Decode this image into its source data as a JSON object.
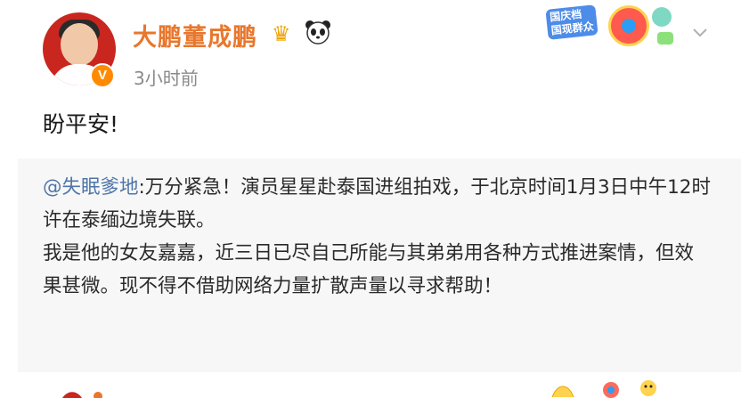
{
  "post": {
    "username": "大鹏董成鹏",
    "timestamp": "3小时前",
    "verified_badge": "V",
    "text": "盼平安!"
  },
  "header_decoration": {
    "banner_text": "国庆档 国现群众"
  },
  "repost": {
    "mention": "@失眠爹地",
    "line1": ":万分紧急！演员星星赴泰国进组拍戏，于北京时间1月3日中午12时许在泰缅边境失联。",
    "line2": "我是他的女友嘉嘉，近三日已尽自己所能与其弟弟用各种方式推进案情，但效果甚微。现不得不借助网络力量扩散声量以寻求帮助！"
  },
  "icons": {
    "crown": "crown-icon",
    "panda": "panda-icon",
    "chevron": "chevron-down-icon"
  },
  "colors": {
    "username": "#e8772d",
    "mention": "#4e76a8",
    "repost_bg": "#f7f7f7",
    "timestamp": "#8a8a8a"
  }
}
